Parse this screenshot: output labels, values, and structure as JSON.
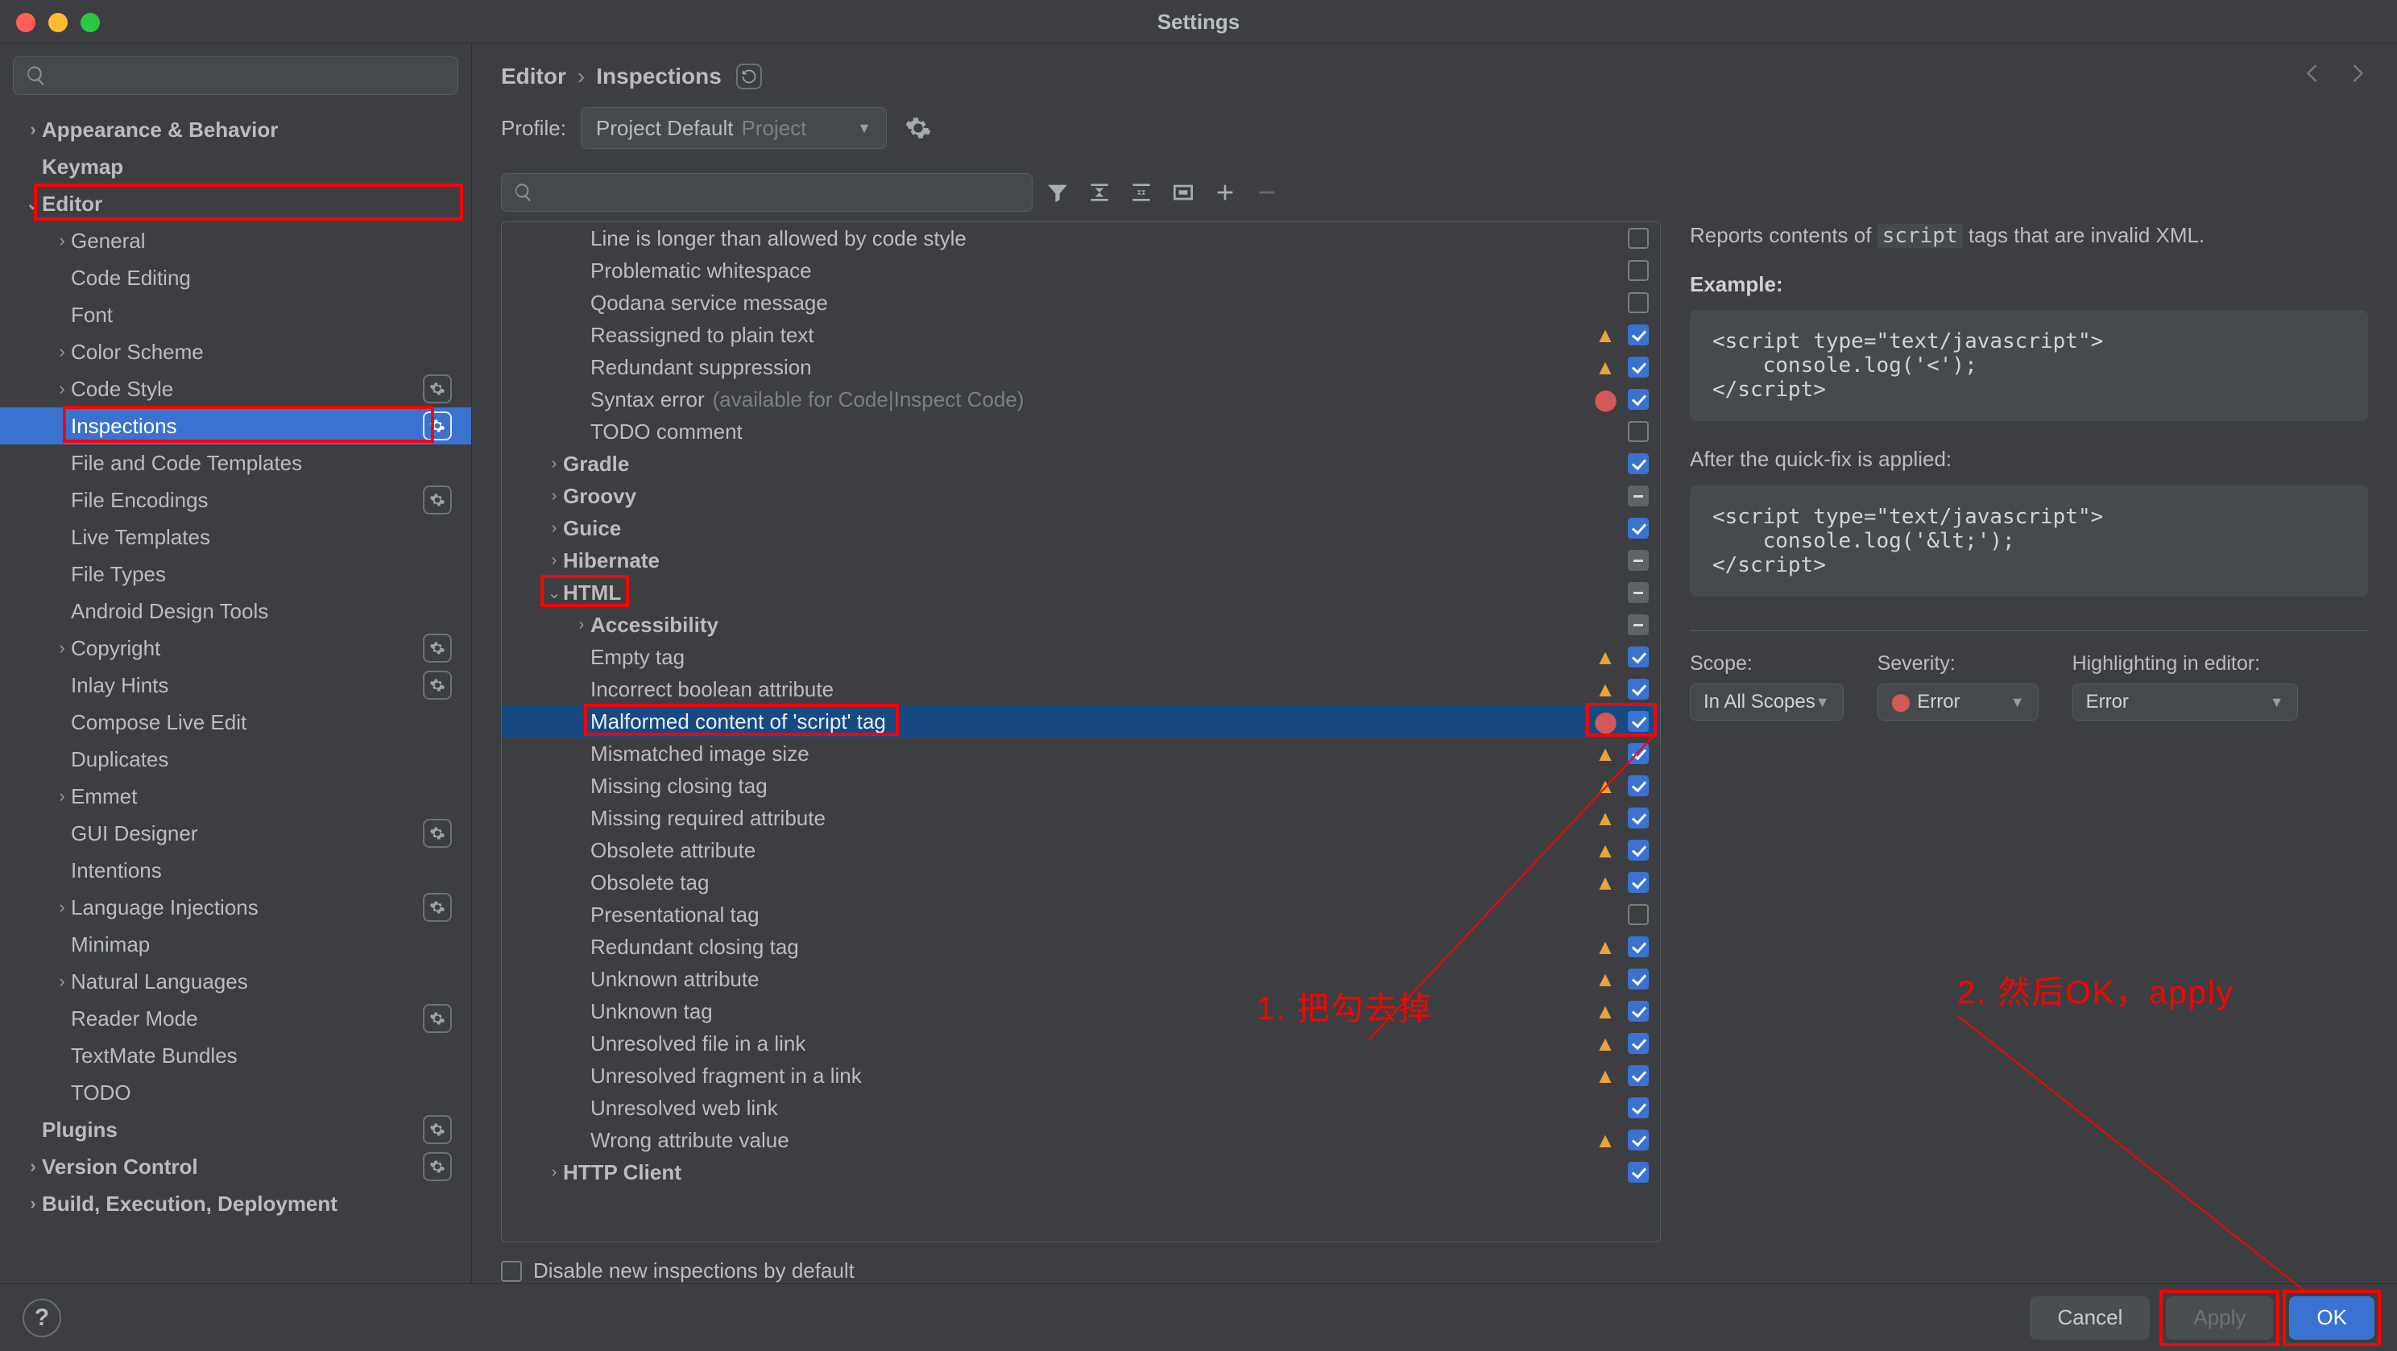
{
  "window_title": "Settings",
  "breadcrumb": {
    "a": "Editor",
    "b": "Inspections"
  },
  "profile": {
    "label": "Profile:",
    "name": "Project Default",
    "scope": "Project"
  },
  "sidebar": [
    {
      "label": "Appearance & Behavior",
      "indent": 0,
      "chev": "right",
      "bold": true
    },
    {
      "label": "Keymap",
      "indent": 0,
      "bold": true
    },
    {
      "label": "Editor",
      "indent": 0,
      "chev": "down",
      "bold": true,
      "boxed": true
    },
    {
      "label": "General",
      "indent": 1,
      "chev": "right"
    },
    {
      "label": "Code Editing",
      "indent": 1
    },
    {
      "label": "Font",
      "indent": 1
    },
    {
      "label": "Color Scheme",
      "indent": 1,
      "chev": "right"
    },
    {
      "label": "Code Style",
      "indent": 1,
      "chev": "right",
      "gear": true
    },
    {
      "label": "Inspections",
      "indent": 1,
      "sel": true,
      "gear": true,
      "boxed": true
    },
    {
      "label": "File and Code Templates",
      "indent": 1
    },
    {
      "label": "File Encodings",
      "indent": 1,
      "gear": true
    },
    {
      "label": "Live Templates",
      "indent": 1
    },
    {
      "label": "File Types",
      "indent": 1
    },
    {
      "label": "Android Design Tools",
      "indent": 1
    },
    {
      "label": "Copyright",
      "indent": 1,
      "chev": "right",
      "gear": true
    },
    {
      "label": "Inlay Hints",
      "indent": 1,
      "gear": true
    },
    {
      "label": "Compose Live Edit",
      "indent": 1
    },
    {
      "label": "Duplicates",
      "indent": 1
    },
    {
      "label": "Emmet",
      "indent": 1,
      "chev": "right"
    },
    {
      "label": "GUI Designer",
      "indent": 1,
      "gear": true
    },
    {
      "label": "Intentions",
      "indent": 1
    },
    {
      "label": "Language Injections",
      "indent": 1,
      "chev": "right",
      "gear": true
    },
    {
      "label": "Minimap",
      "indent": 1
    },
    {
      "label": "Natural Languages",
      "indent": 1,
      "chev": "right"
    },
    {
      "label": "Reader Mode",
      "indent": 1,
      "gear": true
    },
    {
      "label": "TextMate Bundles",
      "indent": 1
    },
    {
      "label": "TODO",
      "indent": 1
    },
    {
      "label": "Plugins",
      "indent": 0,
      "bold": true,
      "gear": true
    },
    {
      "label": "Version Control",
      "indent": 0,
      "chev": "right",
      "bold": true,
      "gear": true
    },
    {
      "label": "Build, Execution, Deployment",
      "indent": 0,
      "chev": "right",
      "bold": true
    }
  ],
  "tree": [
    {
      "label": "Line is longer than allowed by code style",
      "indent": 2,
      "cb": "off"
    },
    {
      "label": "Problematic whitespace",
      "indent": 2,
      "cb": "off"
    },
    {
      "label": "Qodana service message",
      "indent": 2,
      "cb": "off"
    },
    {
      "label": "Reassigned to plain text",
      "indent": 2,
      "cb": "on",
      "sev": "warn"
    },
    {
      "label": "Redundant suppression",
      "indent": 2,
      "cb": "on",
      "sev": "warn"
    },
    {
      "label": "Syntax error",
      "dim": "(available for Code|Inspect Code)",
      "indent": 2,
      "cb": "on",
      "sev": "error"
    },
    {
      "label": "TODO comment",
      "indent": 2,
      "cb": "off"
    },
    {
      "label": "Gradle",
      "indent": 1,
      "chev": "right",
      "bold": true,
      "cb": "on"
    },
    {
      "label": "Groovy",
      "indent": 1,
      "chev": "right",
      "bold": true,
      "cb": "mixed"
    },
    {
      "label": "Guice",
      "indent": 1,
      "chev": "right",
      "bold": true,
      "cb": "on"
    },
    {
      "label": "Hibernate",
      "indent": 1,
      "chev": "right",
      "bold": true,
      "cb": "mixed"
    },
    {
      "label": "HTML",
      "indent": 1,
      "chev": "down",
      "bold": true,
      "cb": "mixed",
      "boxed": true
    },
    {
      "label": "Accessibility",
      "indent": 2,
      "chev": "right",
      "bold": true,
      "cb": "mixed"
    },
    {
      "label": "Empty tag",
      "indent": 2,
      "cb": "on",
      "sev": "warn"
    },
    {
      "label": "Incorrect boolean attribute",
      "indent": 2,
      "cb": "on",
      "sev": "warn"
    },
    {
      "label": "Malformed content of 'script' tag",
      "indent": 2,
      "cb": "on",
      "sev": "error",
      "sel": true,
      "boxed": true,
      "boxedSev": true
    },
    {
      "label": "Mismatched image size",
      "indent": 2,
      "cb": "on",
      "sev": "warn"
    },
    {
      "label": "Missing closing tag",
      "indent": 2,
      "cb": "on",
      "sev": "warn"
    },
    {
      "label": "Missing required attribute",
      "indent": 2,
      "cb": "on",
      "sev": "warn"
    },
    {
      "label": "Obsolete attribute",
      "indent": 2,
      "cb": "on",
      "sev": "warn"
    },
    {
      "label": "Obsolete tag",
      "indent": 2,
      "cb": "on",
      "sev": "warn"
    },
    {
      "label": "Presentational tag",
      "indent": 2,
      "cb": "off"
    },
    {
      "label": "Redundant closing tag",
      "indent": 2,
      "cb": "on",
      "sev": "warn"
    },
    {
      "label": "Unknown attribute",
      "indent": 2,
      "cb": "on",
      "sev": "warn"
    },
    {
      "label": "Unknown tag",
      "indent": 2,
      "cb": "on",
      "sev": "warn"
    },
    {
      "label": "Unresolved file in a link",
      "indent": 2,
      "cb": "on",
      "sev": "warn"
    },
    {
      "label": "Unresolved fragment in a link",
      "indent": 2,
      "cb": "on",
      "sev": "warn"
    },
    {
      "label": "Unresolved web link",
      "indent": 2,
      "cb": "on"
    },
    {
      "label": "Wrong attribute value",
      "indent": 2,
      "cb": "on",
      "sev": "warn"
    },
    {
      "label": "HTTP Client",
      "indent": 1,
      "chev": "right",
      "bold": true,
      "cb": "on"
    }
  ],
  "disable_new_label": "Disable new inspections by default",
  "details": {
    "desc_a": "Reports contents of ",
    "desc_code": "script",
    "desc_b": " tags that are invalid XML.",
    "example_h": "Example:",
    "example_code": "<script type=\"text/javascript\">\n    console.log('<');\n</script>",
    "after_h": "After the quick-fix is applied:",
    "after_code": "<script type=\"text/javascript\">\n    console.log('&lt;');\n</script>",
    "scope_l": "Scope:",
    "scope_v": "In All Scopes",
    "sev_l": "Severity:",
    "sev_v": "Error",
    "hl_l": "Highlighting in editor:",
    "hl_v": "Error"
  },
  "buttons": {
    "cancel": "Cancel",
    "apply": "Apply",
    "ok": "OK"
  },
  "annotations": {
    "t1": "1. 把勾去掉",
    "t2": "2. 然后OK，apply"
  }
}
